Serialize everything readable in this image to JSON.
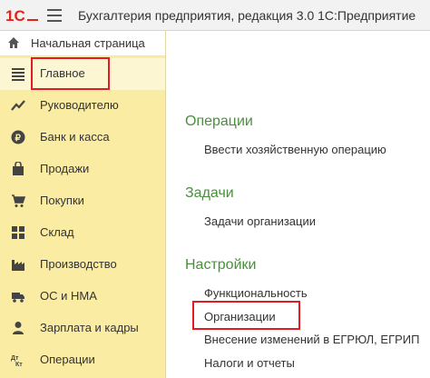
{
  "app": {
    "title": "Бухгалтерия предприятия, редакция 3.0 1С:Предприятие",
    "logo_text": "1С"
  },
  "home": {
    "label": "Начальная страница"
  },
  "sidebar": {
    "items": [
      {
        "label": "Главное",
        "icon": "list-icon"
      },
      {
        "label": "Руководителю",
        "icon": "trend-icon"
      },
      {
        "label": "Банк и касса",
        "icon": "ruble-icon"
      },
      {
        "label": "Продажи",
        "icon": "bag-icon"
      },
      {
        "label": "Покупки",
        "icon": "cart-icon"
      },
      {
        "label": "Склад",
        "icon": "grid-icon"
      },
      {
        "label": "Производство",
        "icon": "factory-icon"
      },
      {
        "label": "ОС и НМА",
        "icon": "truck-icon"
      },
      {
        "label": "Зарплата и кадры",
        "icon": "person-icon"
      },
      {
        "label": "Операции",
        "icon": "dtkt-icon"
      }
    ]
  },
  "main": {
    "sections": [
      {
        "title": "Операции",
        "links": [
          "Ввести хозяйственную операцию"
        ]
      },
      {
        "title": "Задачи",
        "links": [
          "Задачи организации"
        ]
      },
      {
        "title": "Настройки",
        "links": [
          "Функциональность",
          "Организации",
          "Внесение изменений в ЕГРЮЛ, ЕГРИП",
          "Налоги и отчеты"
        ]
      }
    ]
  },
  "colors": {
    "sidebar_bg": "#fbeca3",
    "section_title": "#4a8f3b",
    "highlight": "#e21c24",
    "logo": "#e2231a"
  }
}
